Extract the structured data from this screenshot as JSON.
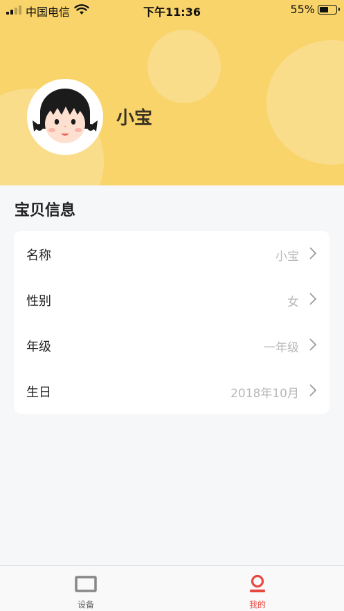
{
  "status_bar": {
    "carrier": "中国电信",
    "time": "下午11:36",
    "battery_percent": "55%",
    "battery_level": 0.55
  },
  "profile": {
    "name": "小宝",
    "avatar_icon": "girl-avatar"
  },
  "section": {
    "title": "宝贝信息"
  },
  "info_rows": [
    {
      "label": "名称",
      "value": "小宝"
    },
    {
      "label": "性别",
      "value": "女"
    },
    {
      "label": "年级",
      "value": "一年级"
    },
    {
      "label": "生日",
      "value": "2018年10月"
    }
  ],
  "tabbar": {
    "tabs": [
      {
        "label": "设备",
        "icon": "device-icon",
        "active": false
      },
      {
        "label": "我的",
        "icon": "profile-icon",
        "active": true
      }
    ]
  },
  "colors": {
    "header_bg": "#f9d46b",
    "accent_red": "#e8473f",
    "page_bg": "#f6f7f9"
  }
}
